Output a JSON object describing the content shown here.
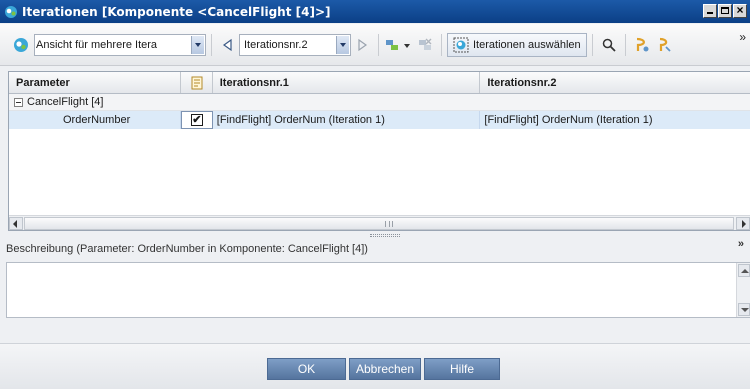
{
  "window": {
    "title": "Iterationen [Komponente <CancelFlight [4]>]",
    "icons": [
      "app-icon",
      "minimize-icon",
      "maximize-icon",
      "close-icon"
    ]
  },
  "toolbar": {
    "view_combo": "Ansicht für mehrere Itera",
    "iteration_combo": "Iterationsnr.2",
    "select_iterations": "Iterationen auswählen",
    "overflow": "»"
  },
  "grid": {
    "columns": [
      "Parameter",
      "",
      "Iterationsnr.1",
      "Iterationsnr.2"
    ],
    "group_label": "CancelFlight [4]",
    "rows": [
      {
        "parameter": "OrderNumber",
        "checked": "✔",
        "iteration1": "[FindFlight] OrderNum (Iteration 1)",
        "iteration2": "[FindFlight] OrderNum (Iteration 1)"
      }
    ]
  },
  "description": {
    "label": "Beschreibung (Parameter: OrderNumber in Komponente: CancelFlight [4])",
    "collapse": "»",
    "text": ""
  },
  "buttons": {
    "ok": "OK",
    "cancel": "Abbrechen",
    "help": "Hilfe"
  },
  "colors": {
    "titlebar": "#0b3f86",
    "selected_row": "#dceaf8",
    "dialog_button": "#6787b2"
  }
}
